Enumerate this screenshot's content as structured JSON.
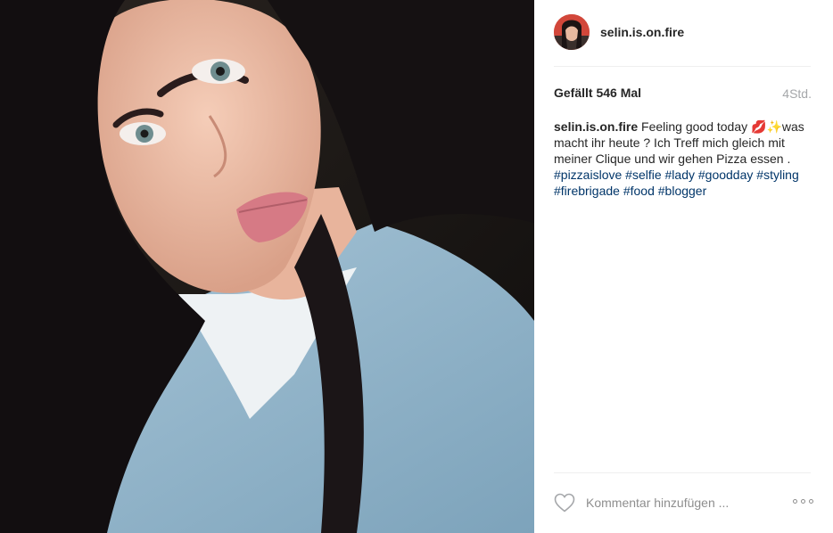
{
  "post": {
    "image_alt": "Selfie",
    "username": "selin.is.on.fire",
    "likes_text": "Gefällt 546 Mal",
    "time_text": "4Std.",
    "caption": {
      "username": "selin.is.on.fire",
      "text": "Feeling good today 💋✨was macht ihr heute ? Ich Treff mich gleich mit meiner Clique und wir gehen Pizza essen .",
      "hashtags": [
        "#pizzaislove",
        "#selfie",
        "#lady",
        "#goodday",
        "#styling",
        "#firebrigade",
        "#food",
        "#blogger"
      ]
    }
  },
  "footer": {
    "comment_placeholder": "Kommentar hinzufügen ...",
    "like_icon": "heart-outline-icon",
    "more_icon": "more-options-icon"
  },
  "colors": {
    "text": "#262626",
    "hashtag": "#003569",
    "muted": "#a5a7aa",
    "divider": "#efefef"
  }
}
